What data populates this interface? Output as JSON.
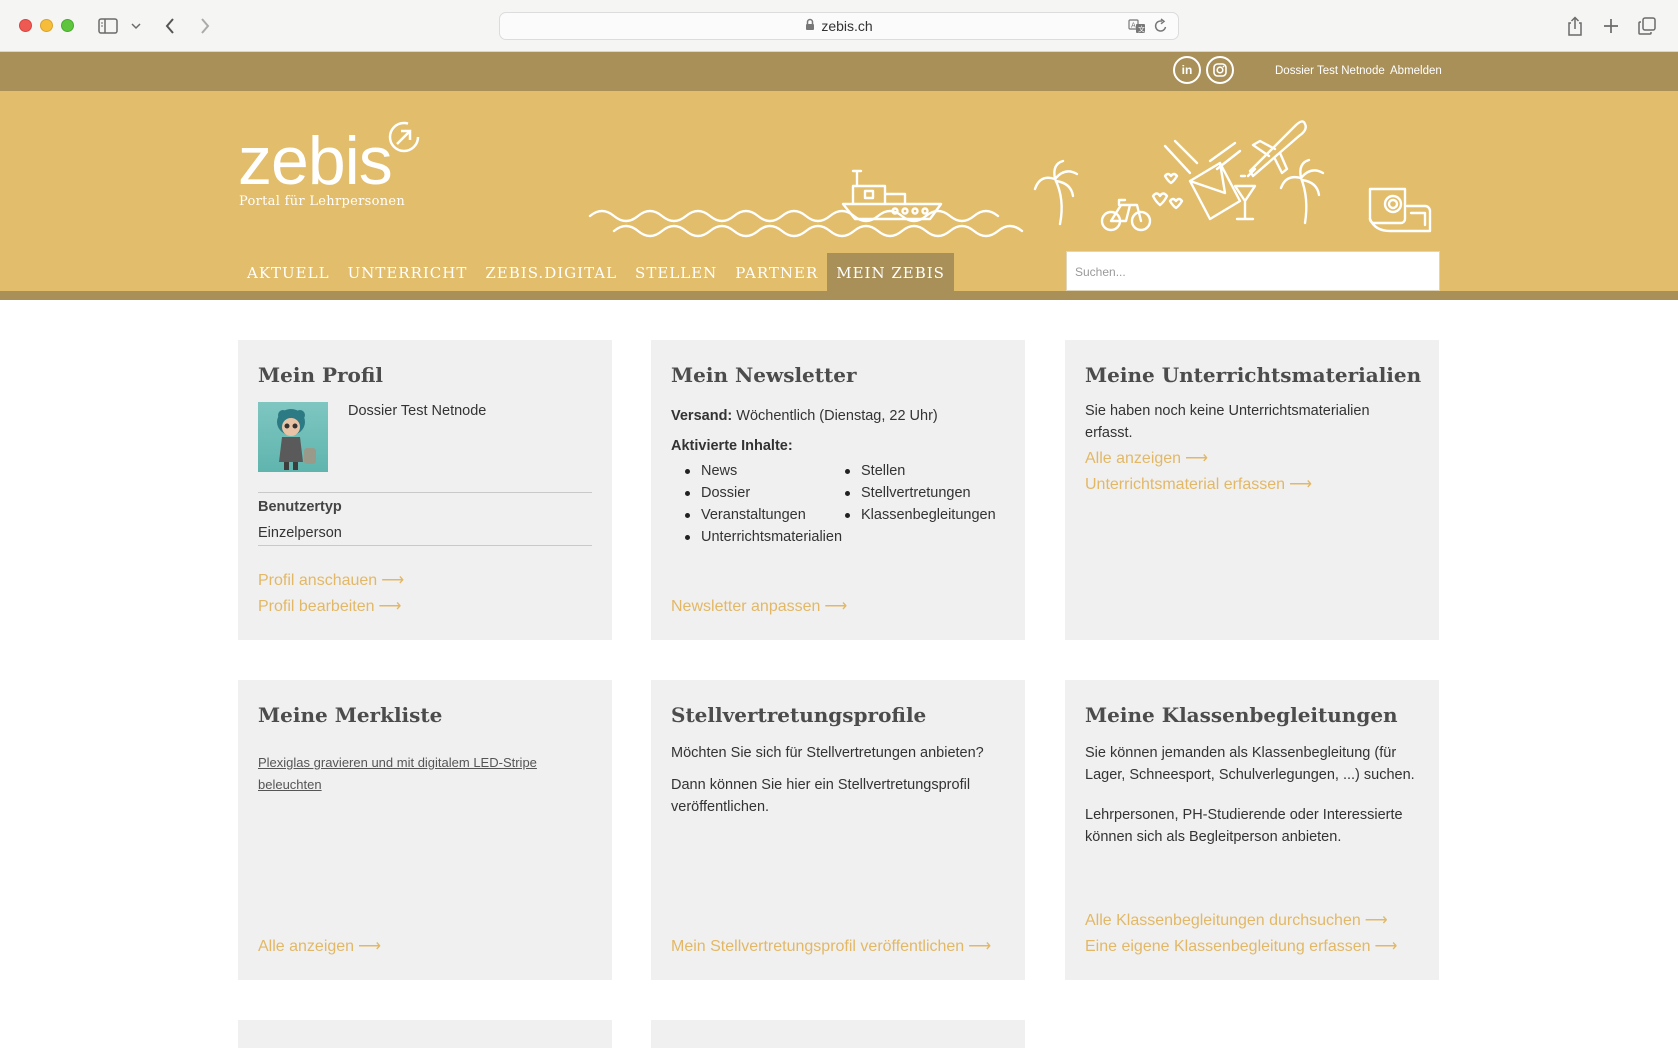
{
  "browser": {
    "url": "zebis.ch"
  },
  "topbar": {
    "social": [
      {
        "label": "in",
        "icon": "linkedin-icon"
      },
      {
        "label": "◎",
        "icon": "instagram-icon"
      }
    ],
    "user_link": "Dossier Test Netnode",
    "logout_link": "Abmelden"
  },
  "header": {
    "logo_text": "zebis",
    "logo_subtitle": "Portal für Lehrpersonen",
    "search_placeholder": "Suchen...",
    "nav": [
      {
        "label": "AKTUELL"
      },
      {
        "label": "UNTERRICHT"
      },
      {
        "label": "ZEBIS.DIGITAL"
      },
      {
        "label": "STELLEN"
      },
      {
        "label": "PARTNER"
      },
      {
        "label": "MEIN ZEBIS",
        "active": true
      }
    ]
  },
  "colors": {
    "brand": "#e2bd6b",
    "brand_dark": "#a99059",
    "link": "#e2b866",
    "card_bg": "#f0f0f0"
  },
  "cards": {
    "profile": {
      "title": "Mein Profil",
      "name": "Dossier Test Netnode",
      "type_label": "Benutzertyp",
      "type_value": "Einzelperson",
      "link_view": "Profil anschauen",
      "link_edit": "Profil bearbeiten"
    },
    "newsletter": {
      "title": "Mein Newsletter",
      "versand_label": "Versand:",
      "versand_value": "Wöchentlich (Dienstag, 22 Uhr)",
      "content_label": "Aktivierte Inhalte:",
      "col1": [
        "News",
        "Dossier",
        "Veranstaltungen",
        "Unterrichtsmaterialien"
      ],
      "col2": [
        "Stellen",
        "Stellvertretungen",
        "Klassenbegleitungen"
      ],
      "link": "Newsletter anpassen"
    },
    "materials": {
      "title": "Meine Unterrichtsmaterialien",
      "text": "Sie haben noch keine Unterrichtsmaterialien erfasst.",
      "link_all": "Alle anzeigen",
      "link_add": "Unterrichtsmaterial erfassen"
    },
    "merkliste": {
      "title": "Meine Merkliste",
      "item": "Plexiglas gravieren und mit digitalem LED-Stripe beleuchten",
      "link": "Alle anzeigen"
    },
    "stellvertretung": {
      "title": "Stellvertretungsprofile",
      "text1": "Möchten Sie sich für Stellvertretungen anbieten?",
      "text2": "Dann können Sie hier ein Stellvertretungsprofil veröffentlichen.",
      "link": "Mein Stellvertretungsprofil veröffentlichen"
    },
    "klassen": {
      "title": "Meine Klassenbegleitungen",
      "text1": "Sie können jemanden als Klassenbegleitung (für Lager, Schneesport, Schulverlegungen, ...) suchen.",
      "text2": "Lehrpersonen, PH-Studierende oder Interessierte können sich als Begleitperson anbieten.",
      "link_search": "Alle Klassenbegleitungen durchsuchen",
      "link_add": "Eine eigene Klassenbegleitung erfassen"
    }
  }
}
